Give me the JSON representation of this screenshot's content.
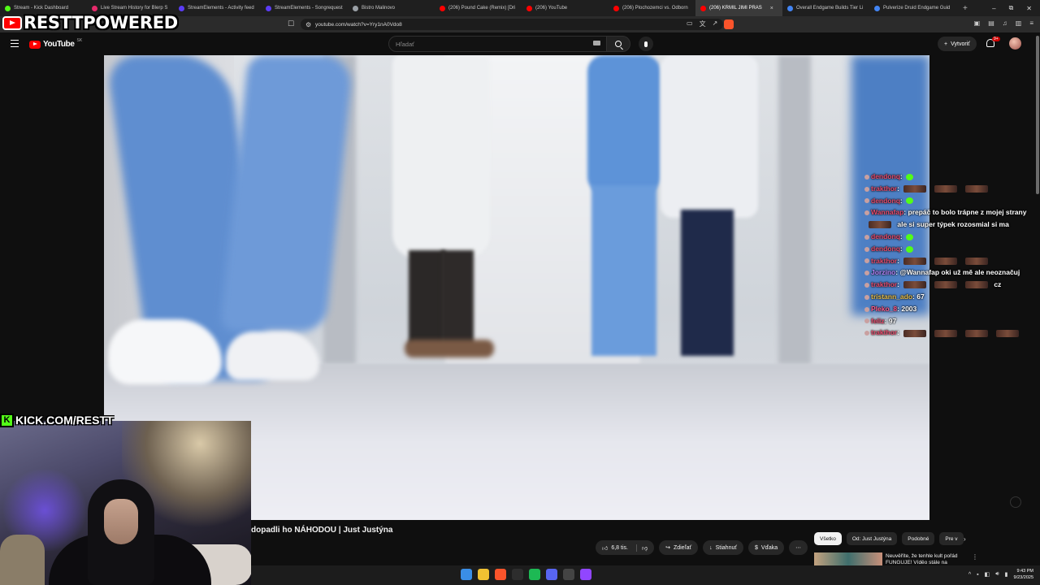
{
  "browser": {
    "tabs": [
      {
        "label": "Stream - Kick Dashboard",
        "color": "#53fc18",
        "width": 107
      },
      {
        "label": "Live Stream History for Blerp S",
        "color": "#e62a6b",
        "width": 107
      },
      {
        "label": "StreamElements - Activity feed",
        "color": "#5b3cf5",
        "width": 107
      },
      {
        "label": "StreamElements - Songrequest",
        "color": "#5b3cf5",
        "width": 107
      },
      {
        "label": "Bistro Malinovo",
        "color": "#9aa0a6",
        "width": 107
      },
      {
        "label": "(206) Pound Cake (Remix) [Dri",
        "color": "#ff0000",
        "width": 107
      },
      {
        "label": "(206) YouTube",
        "color": "#ff0000",
        "width": 107
      },
      {
        "label": "(206) Plochozemci vs. Odborn",
        "color": "#ff0000",
        "width": 107
      },
      {
        "label": "(206) KRMIL JIMI PRAS",
        "color": "#ff0000",
        "width": 107,
        "active": true
      },
      {
        "label": "Overall Endgame Builds Tier Li",
        "color": "#4285f4",
        "width": 107
      },
      {
        "label": "Pulverize Druid Endgame Guid",
        "color": "#4285f4",
        "width": 107
      }
    ],
    "new_tab": "+",
    "tab_close": "×",
    "window_controls": [
      "–",
      "⧉",
      "✕"
    ],
    "url": "youtube.com/watch?v=Yry1nA0Vdo8"
  },
  "youtube": {
    "logo_text": "YouTube",
    "country": "SK",
    "search_placeholder": "Hľadať",
    "create_label": "Vytvoriť",
    "notifications_badge": "9+",
    "video_title": "dopadli ho NÁHODOU | Just Justýna",
    "actions": {
      "like": "6,8 tis.",
      "share": "Zdieľať",
      "download": "Stiahnuť",
      "thanks": "Vďaka",
      "more": "⋯"
    },
    "chips": [
      "Všetko",
      "Od: Just Justýna",
      "Podobné",
      "Pre v"
    ],
    "recommendation_title": "Neuvěříte, že tenhle kult pořád FUNGUJE! Víděo stále na"
  },
  "chat": {
    "messages": [
      {
        "user": "dendonq",
        "sep": ":",
        "text": "",
        "kick_emote": true,
        "emotes": 0,
        "color": "red"
      },
      {
        "user": "trakthor",
        "sep": ":",
        "text": "",
        "emotes": 3,
        "color": "red"
      },
      {
        "user": "dendonq",
        "sep": ":",
        "text": "",
        "kick_emote": true,
        "emotes": 0,
        "color": "red"
      },
      {
        "user": "Wannafap",
        "sep": ":",
        "text": " prepáč to bolo trápne z mojej strany ",
        "emotes": 1,
        "text_after": " ale si super týpek rozosmial si ma",
        "color": "red"
      },
      {
        "user": "dendonq",
        "sep": ":",
        "text": "",
        "kick_emote": true,
        "emotes": 0,
        "color": "red"
      },
      {
        "user": "dendonq",
        "sep": ":",
        "text": "",
        "kick_emote": true,
        "emotes": 0,
        "color": "red"
      },
      {
        "user": "trakthor",
        "sep": ":",
        "text": "",
        "emotes": 3,
        "color": "red"
      },
      {
        "user": "Jorzino",
        "sep": ":",
        "text": " @Wannafap oki už mě ale neoznačuj",
        "emotes": 0,
        "color": "purple"
      },
      {
        "user": "trakthor",
        "sep": ":",
        "text": "",
        "emotes": 3,
        "text_after": " cz",
        "color": "red"
      },
      {
        "user": "tristann_ado",
        "sep": ":",
        "text": " 67",
        "emotes": 0,
        "color": "yellow"
      },
      {
        "user": "Pleko_8",
        "sep": ":",
        "text": " 2003",
        "emotes": 0,
        "color": "pink"
      },
      {
        "user": "feliz",
        "sep": ":",
        "text": " 97",
        "emotes": 0,
        "color": "red"
      },
      {
        "user": "trakthor",
        "sep": ":",
        "text": "",
        "emotes": 4,
        "color": "red"
      }
    ]
  },
  "overlay": {
    "brand": "RESTTPOWERED",
    "kick_k": "K",
    "kick_url": "KICK.COM/RESTT"
  },
  "taskbar": {
    "apps": [
      {
        "name": "start",
        "color": "#3a8ee6"
      },
      {
        "name": "explorer",
        "color": "#f1c232"
      },
      {
        "name": "brave",
        "color": "#fb542b"
      },
      {
        "name": "terminal",
        "color": "#2d2d2d"
      },
      {
        "name": "spotify",
        "color": "#1db954"
      },
      {
        "name": "discord",
        "color": "#5865f2"
      },
      {
        "name": "obs",
        "color": "#444444"
      },
      {
        "name": "twitch",
        "color": "#9146ff"
      }
    ],
    "time": "9:43 PM",
    "date": "9/23/2025"
  }
}
